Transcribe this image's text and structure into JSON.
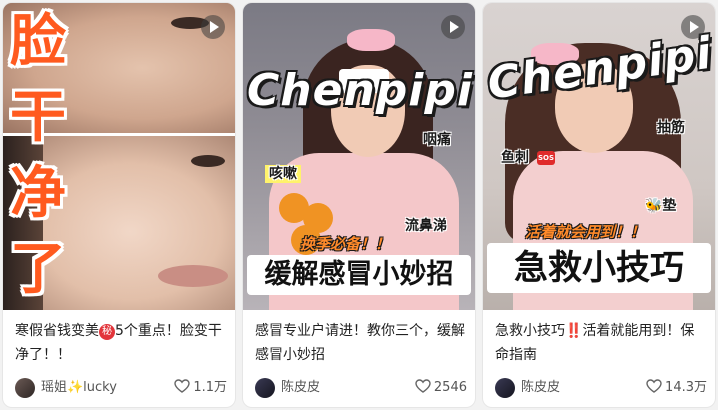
{
  "feed": {
    "cards": [
      {
        "cover": {
          "big_words": [
            "脸",
            "干",
            "净",
            "了"
          ]
        },
        "title_before": "寒假省钱变美",
        "title_mark": "秘",
        "title_after": "5个重点！脸变干净了！！",
        "author": "瑶姐✨lucky",
        "likes": "1.1万"
      },
      {
        "cover": {
          "brand": "Chenpipi",
          "stickers": [
            "咽痛",
            "咳嗽",
            "流鼻涕"
          ],
          "tagline": "换季必备！！",
          "headline": "缓解感冒小妙招"
        },
        "title": "感冒专业户请进！教你三个，缓解感冒小妙招",
        "author": "陈皮皮",
        "likes": "2546"
      },
      {
        "cover": {
          "brand": "Chenpipi",
          "stickers": [
            "抽筋",
            "鱼刺",
            "SOS",
            "🐝垫"
          ],
          "tagline": "活着就会用到！！",
          "headline": "急救小技巧"
        },
        "title_before": "急救小技巧",
        "title_mark": "‼️",
        "title_after": "活着就能用到！保命指南",
        "author": "陈皮皮",
        "likes": "14.3万"
      }
    ]
  },
  "icons": {
    "video": "play-icon",
    "like": "heart-icon"
  },
  "colors": {
    "accent_orange": "#ff5a1f",
    "mark_red": "#e2353b",
    "text": "#222222",
    "meta": "#555555"
  }
}
